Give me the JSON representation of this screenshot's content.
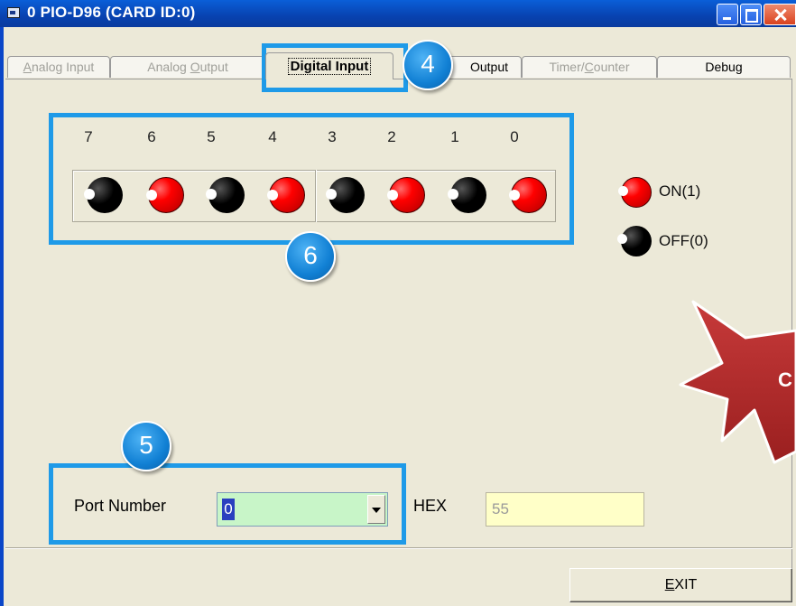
{
  "window": {
    "title": "0 PIO-D96 (CARD ID:0)"
  },
  "tabs": [
    {
      "label": "Analog Input",
      "mnemonic": "A"
    },
    {
      "label": "Analog Output",
      "mnemonic": "O"
    },
    {
      "label": "Digital Input",
      "mnemonic": ""
    },
    {
      "label": "Output"
    },
    {
      "label": "Timer/Counter"
    },
    {
      "label": "Debug"
    }
  ],
  "digital_input": {
    "bits": [
      {
        "label": "7",
        "state": "off"
      },
      {
        "label": "6",
        "state": "on"
      },
      {
        "label": "5",
        "state": "off"
      },
      {
        "label": "4",
        "state": "on"
      },
      {
        "label": "3",
        "state": "off"
      },
      {
        "label": "2",
        "state": "on"
      },
      {
        "label": "1",
        "state": "off"
      },
      {
        "label": "0",
        "state": "on"
      }
    ],
    "legend": {
      "on_label": "ON(1)",
      "off_label": "OFF(0)",
      "on_color": "#ff0000",
      "off_color": "#000000"
    }
  },
  "port": {
    "label": "Port Number",
    "value": "0",
    "field_color": "#c8f5c8"
  },
  "hex": {
    "label": "HEX",
    "value": "55",
    "field_color": "#ffffc8"
  },
  "exit_button": {
    "label": "EXIT"
  },
  "callouts": {
    "badge_4": "4",
    "badge_5": "5",
    "badge_6": "6",
    "partial_label": "C",
    "highlight_color": "#1e9ae8",
    "star_color": "#b22a2a"
  }
}
